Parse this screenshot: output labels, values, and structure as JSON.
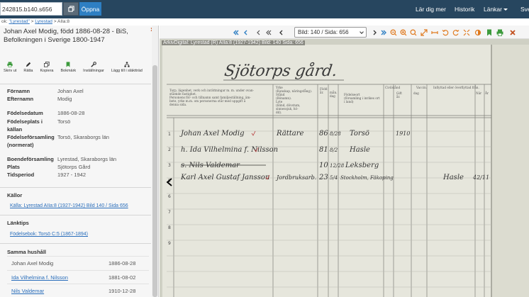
{
  "topbar": {
    "ref_value": "242815.b140.s656",
    "open_label": "Öppna",
    "links": [
      "Lär dig mer",
      "Historik",
      "Länkar",
      "Sve"
    ]
  },
  "breadcrumb": {
    "prefix": "ok: ",
    "item1": "\"Lyrestad\"",
    "sep": " > ",
    "item2": "Lyrestad",
    "item3": "AIIa:8"
  },
  "sidebar": {
    "title": "Johan Axel Modig, född 1886-08-28 - BiS, Befolkningen i Sverige 1800-1947",
    "close_label": "×",
    "actions": [
      {
        "label": "Skriv ut",
        "icon": "print-icon"
      },
      {
        "label": "Rätta",
        "icon": "edit-icon"
      },
      {
        "label": "Kopiera",
        "icon": "copy-icon"
      },
      {
        "label": "Bokmärk",
        "icon": "bookmark-icon"
      },
      {
        "label": "Inställningar",
        "icon": "wrench-icon"
      },
      {
        "label": "Lägg till i släktträd",
        "icon": "family-tree-icon"
      }
    ],
    "fields": [
      {
        "label": "Förnamn",
        "value": "Johan Axel"
      },
      {
        "label": "Efternamn",
        "value": "Modig"
      },
      {
        "label": "Födelsedatum",
        "value": "1886-08-28"
      },
      {
        "label": "Födelseplats i",
        "value": "Torsö"
      },
      {
        "label": "källan",
        "value": ""
      },
      {
        "label": "Födelseförsamling",
        "value": "Torsö, Skaraborgs län"
      },
      {
        "label": "(normerat)",
        "value": ""
      },
      {
        "label": "Boendeförsamling",
        "value": "Lyrestad, Skaraborgs län"
      },
      {
        "label": "Plats",
        "value": "Sjötorps Gård"
      },
      {
        "label": "Tidsperiod",
        "value": "1927 - 1942"
      }
    ],
    "sources_heading": "Källor",
    "source_link": "Källa: Lyrestad AIIa:8 (1927-1942) Bild 140 / Sida 656",
    "linktips_heading": "Länktips",
    "linktip_link": "Födelsebok: Torsö C:5 (1867-1894)",
    "household_heading": "Samma hushåll",
    "household": [
      {
        "name": "Johan Axel Modig",
        "date": "1886-08-28",
        "link": false
      },
      {
        "name": "Ida Vilhelmina f. Nilsson",
        "date": "1881-08-02",
        "link": true
      },
      {
        "name": "Nils Valdemar",
        "date": "1910-12-28",
        "link": true
      }
    ]
  },
  "viewer": {
    "page_select": "Bild: 140 / Sida: 656",
    "caption": "ArkivDigital: Lyrestad (R) AIIa:8 (1927-1942) Bild: 140 Sida: 656",
    "colors": {
      "navbar": "#27465f",
      "accent": "#2e7fc3",
      "toolbar_orange": "#e07a1f",
      "toolbar_green": "#3c9a3c"
    }
  },
  "document": {
    "heading": "Sjötorps gård.",
    "col_headers": [
      "Torp, lägenhet, verk och inrättningar m. m. under ovan-\nstående fastighet.\nPersonens för- och tillnamn samt familjeställning, äm-\nbete, yrke m.m. om personerna står med uppgift å\ndenna sida.",
      "Yrke\n(Kunskap, näringsfång).\nStånd\n(Bönamn).\nLyte\n(blind, dövstum,\nsinnessjuk, hö-\ndd).",
      "Född\n\når.",
      "\nmån.\ndag",
      "Födelseort\n(församling i inrikes ort\ni land)",
      "Civilstånd",
      "Gift\når.",
      "dag",
      "Vaccin.",
      "Inflyttad eller överflyttad från.",
      "När",
      "År"
    ],
    "rows": [
      {
        "name": "Johan Axel Modig",
        "yrke": "Rättare",
        "yr": "86",
        "md": "8/28",
        "ort": "Torsö",
        "gift": "1910"
      },
      {
        "name": "h. Ida Vilhelmina f. Nilsson",
        "yrke": "",
        "yr": "81",
        "md": "8/2",
        "ort": "Hasle",
        "gift": ""
      },
      {
        "name": "s. Nils Valdemar",
        "yrke": "",
        "yr": "10",
        "md": "12/28",
        "ort": "Leksberg",
        "gift": ""
      },
      {
        "name": "Karl Axel Gustaf Jansson",
        "yrke": "Jordbruksarb.",
        "yr": "23",
        "md": "5/4",
        "ort": "Stockholm, Fäkoping",
        "gift": "",
        "inflyttad": "Hasle",
        "when": "42/11",
        "extra": "Stockholm"
      }
    ]
  }
}
